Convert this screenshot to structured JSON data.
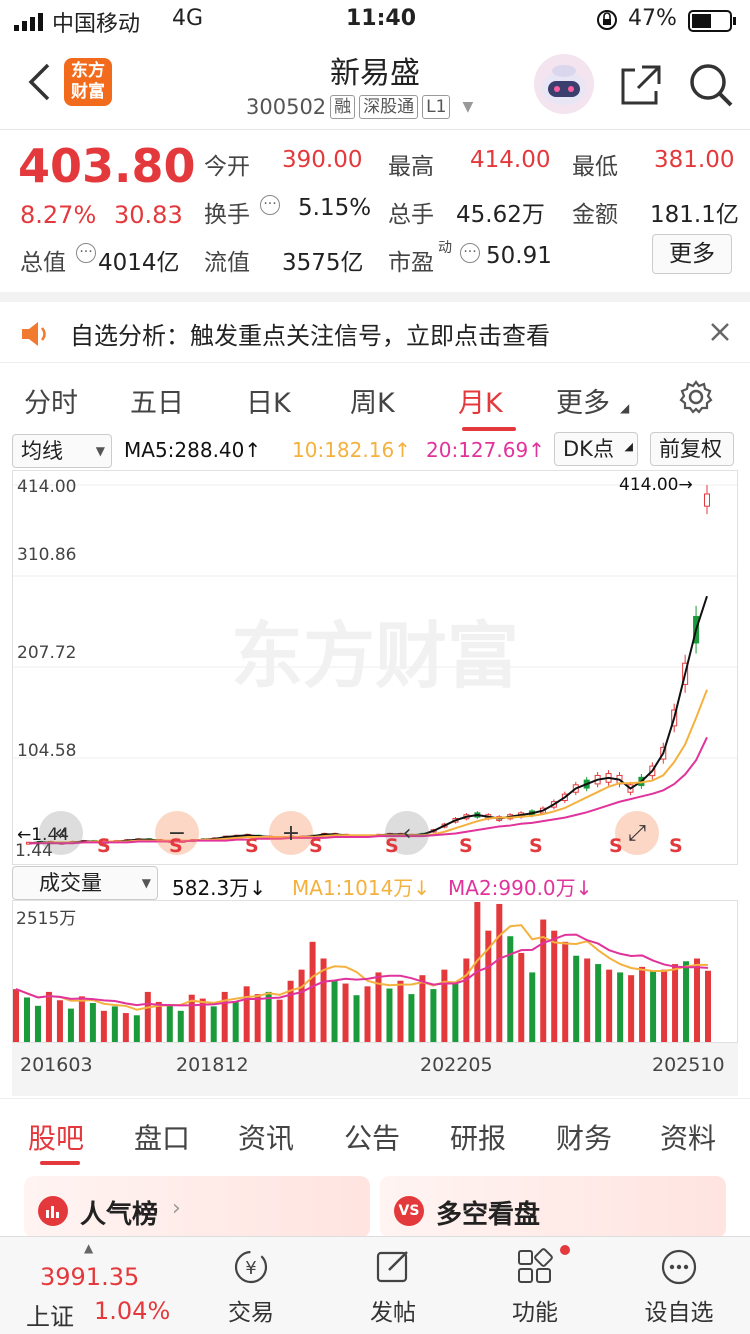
{
  "status_bar": {
    "carrier": "中国移动",
    "network": "4G",
    "time": "11:40",
    "battery": "47%"
  },
  "header": {
    "title": "新易盛",
    "code": "300502",
    "tags": [
      "融",
      "深股通",
      "L1"
    ],
    "logo_text": "东方\n财富"
  },
  "quote": {
    "price": "403.80",
    "change_pct": "8.27%",
    "change": "30.83",
    "open_label": "今开",
    "open": "390.00",
    "high_label": "最高",
    "high": "414.00",
    "low_label": "最低",
    "low": "381.00",
    "turnover_label": "换手",
    "turnover": "5.15%",
    "volume_label": "总手",
    "volume": "45.62万",
    "amount_label": "金额",
    "amount": "181.1亿",
    "mktcap_label": "总值",
    "mktcap": "4014亿",
    "float_label": "流值",
    "float": "3575亿",
    "pe_label": "市盈",
    "pe_sup": "动",
    "pe": "50.91",
    "more_button": "更多"
  },
  "notice": {
    "text": "自选分析：触发重点关注信号，立即点击查看"
  },
  "chart_tabs": {
    "items": [
      "分时",
      "五日",
      "日K",
      "周K",
      "月K",
      "更多"
    ],
    "active": "月K"
  },
  "ma_bar": {
    "selector": "均线",
    "ma5": "MA5:288.40↑",
    "ma10": "10:182.16↑",
    "ma20": "20:127.69↑",
    "dk_button": "DK点",
    "adjust_button": "前复权"
  },
  "chart_data": {
    "type": "line",
    "y_ticks": [
      "414.00",
      "310.86",
      "207.72",
      "104.58",
      "1.44"
    ],
    "ylim": [
      1.44,
      414.0
    ],
    "max_label": "414.00→",
    "min_label": "←1.44",
    "x_labels": [
      "201603",
      "201812",
      "202205",
      "202510"
    ],
    "watermark": "东方财富",
    "signal_marks": [
      "S",
      "S",
      "S",
      "S",
      "S",
      "S",
      "S",
      "S",
      "S"
    ],
    "series": [
      {
        "values": [
          8,
          9,
          9,
          8,
          9,
          10,
          10,
          9,
          10,
          11,
          12,
          12,
          11,
          10,
          10,
          11,
          12,
          13,
          15,
          16,
          17,
          16,
          15,
          14,
          15,
          15,
          16,
          18,
          18,
          17,
          16,
          16,
          17,
          18,
          18,
          17,
          18,
          22,
          28,
          34,
          38,
          40,
          38,
          36,
          38,
          40,
          42,
          45,
          52,
          60,
          70,
          75,
          80,
          82,
          80,
          70,
          78,
          90,
          110,
          150,
          200,
          250,
          288
        ]
      },
      {
        "values": [
          8,
          8,
          9,
          9,
          9,
          9,
          10,
          10,
          10,
          10,
          11,
          11,
          11,
          11,
          11,
          11,
          12,
          12,
          13,
          14,
          15,
          15,
          15,
          15,
          15,
          15,
          15,
          16,
          17,
          17,
          17,
          17,
          17,
          17,
          17,
          17,
          17,
          18,
          21,
          25,
          29,
          33,
          36,
          37,
          37,
          38,
          39,
          41,
          44,
          48,
          54,
          60,
          66,
          72,
          76,
          76,
          77,
          79,
          85,
          100,
          120,
          150,
          182
        ]
      },
      {
        "values": [
          8,
          8,
          8,
          8,
          8,
          9,
          9,
          9,
          9,
          9,
          10,
          10,
          10,
          10,
          10,
          11,
          11,
          11,
          11,
          12,
          12,
          13,
          13,
          13,
          14,
          14,
          14,
          14,
          15,
          15,
          15,
          15,
          16,
          16,
          16,
          16,
          16,
          17,
          18,
          19,
          21,
          23,
          25,
          27,
          28,
          30,
          31,
          33,
          35,
          37,
          40,
          43,
          47,
          51,
          55,
          58,
          61,
          64,
          68,
          75,
          86,
          102,
          128
        ]
      }
    ]
  },
  "volume": {
    "selector": "成交量",
    "current": "582.3万↓",
    "ma1": "MA1:1014万↓",
    "ma2": "MA2:990.0万↓",
    "max_label": "2515万"
  },
  "volume_data": {
    "values": [
      950,
      800,
      650,
      900,
      750,
      600,
      820,
      700,
      560,
      640,
      520,
      480,
      900,
      720,
      680,
      560,
      850,
      780,
      640,
      900,
      720,
      1000,
      860,
      900,
      760,
      1100,
      1300,
      1800,
      1500,
      1100,
      1050,
      840,
      1000,
      1250,
      960,
      1100,
      860,
      1200,
      950,
      1300,
      1050,
      1500,
      2515,
      2000,
      2480,
      1900,
      1600,
      1250,
      2200,
      2000,
      1800,
      1550,
      1500,
      1400,
      1300,
      1250,
      1200,
      1350,
      1280,
      1300,
      1400,
      1450,
      1500,
      1280
    ],
    "up": [
      1,
      0,
      0,
      1,
      1,
      0,
      1,
      0,
      1,
      0,
      1,
      0,
      1,
      1,
      0,
      0,
      1,
      1,
      0,
      1,
      0,
      1,
      1,
      0,
      1,
      1,
      1,
      1,
      1,
      0,
      1,
      0,
      1,
      1,
      0,
      1,
      0,
      1,
      0,
      1,
      0,
      1,
      1,
      1,
      1,
      0,
      1,
      0,
      1,
      1,
      1,
      0,
      1,
      0,
      1,
      0,
      1,
      1,
      0,
      1,
      1,
      0,
      1,
      1
    ]
  },
  "bottom_tabs": {
    "items": [
      "股吧",
      "盘口",
      "资讯",
      "公告",
      "研报",
      "财务",
      "资料"
    ],
    "active": "股吧"
  },
  "cards": [
    {
      "label": "人气榜"
    },
    {
      "label": "多空看盘"
    }
  ],
  "dock": {
    "index_value": "3991.35",
    "index_name": "上证",
    "index_change": "1.04%",
    "items": [
      "交易",
      "发帖",
      "功能",
      "设自选"
    ]
  },
  "colors": {
    "up": "#e4393c",
    "down": "#1a9a3a",
    "ma5": "#111111",
    "ma10": "#f4b13e",
    "ma20": "#e0339b"
  }
}
